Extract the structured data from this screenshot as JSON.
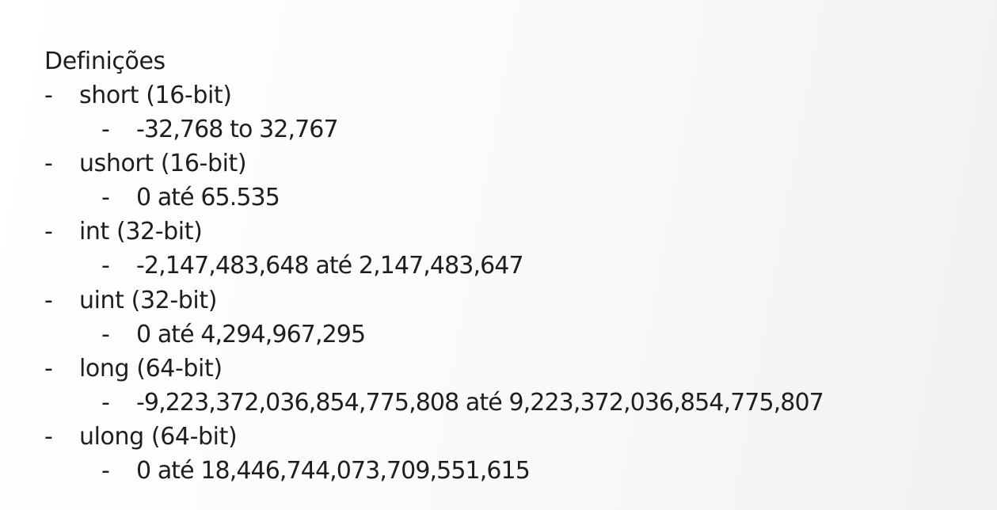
{
  "slide": {
    "title": "Definições",
    "bullet": "-",
    "items": [
      {
        "label": "short (16-bit)",
        "range": "-32,768 to 32,767"
      },
      {
        "label": "ushort (16-bit)",
        "range": "0 até 65.535"
      },
      {
        "label": "int (32-bit)",
        "range": "-2,147,483,648 até 2,147,483,647"
      },
      {
        "label": "uint (32-bit)",
        "range": "0 até 4,294,967,295"
      },
      {
        "label": "long (64-bit)",
        "range": "-9,223,372,036,854,775,808 até 9,223,372,036,854,775,807"
      },
      {
        "label": "ulong (64-bit)",
        "range": "0 até 18,446,744,073,709,551,615"
      }
    ]
  }
}
